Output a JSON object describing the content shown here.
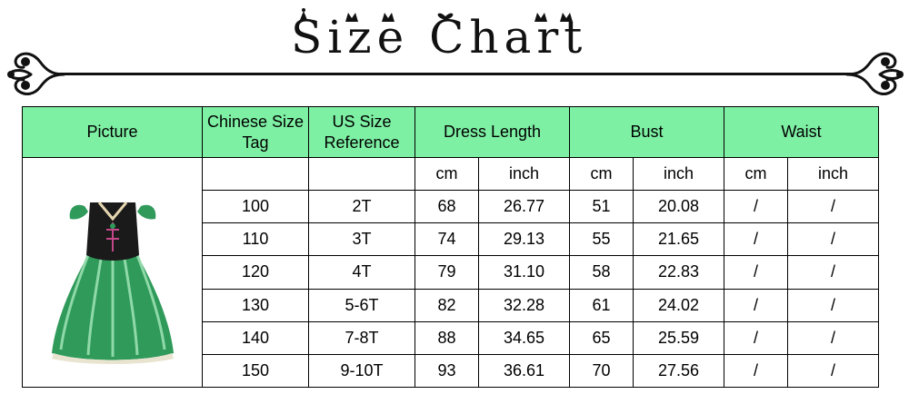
{
  "title": "Size Chart",
  "header": {
    "picture": "Picture",
    "chinese_tag": "Chinese Size Tag",
    "us_ref": "US Size Reference",
    "dress_length": "Dress Length",
    "bust": "Bust",
    "waist": "Waist"
  },
  "units": [
    "cm",
    "inch",
    "cm",
    "inch",
    "cm",
    "inch"
  ],
  "rows": [
    {
      "tag": "100",
      "us": "2T",
      "len_cm": "68",
      "len_in": "26.77",
      "bust_cm": "51",
      "bust_in": "20.08",
      "waist_cm": "/",
      "waist_in": "/"
    },
    {
      "tag": "110",
      "us": "3T",
      "len_cm": "74",
      "len_in": "29.13",
      "bust_cm": "55",
      "bust_in": "21.65",
      "waist_cm": "/",
      "waist_in": "/"
    },
    {
      "tag": "120",
      "us": "4T",
      "len_cm": "79",
      "len_in": "31.10",
      "bust_cm": "58",
      "bust_in": "22.83",
      "waist_cm": "/",
      "waist_in": "/"
    },
    {
      "tag": "130",
      "us": "5-6T",
      "len_cm": "82",
      "len_in": "32.28",
      "bust_cm": "61",
      "bust_in": "24.02",
      "waist_cm": "/",
      "waist_in": "/"
    },
    {
      "tag": "140",
      "us": "7-8T",
      "len_cm": "88",
      "len_in": "34.65",
      "bust_cm": "65",
      "bust_in": "25.59",
      "waist_cm": "/",
      "waist_in": "/"
    },
    {
      "tag": "150",
      "us": "9-10T",
      "len_cm": "93",
      "len_in": "36.61",
      "bust_cm": "70",
      "bust_in": "27.56",
      "waist_cm": "/",
      "waist_in": "/"
    }
  ],
  "colors": {
    "header_bg": "#7ef0a4",
    "border": "#000000",
    "dress_green": "#2f9a5a",
    "dress_bodice": "#1a1a1a"
  },
  "icons": [
    "flourish-ornament-icon",
    "crown-icon",
    "bow-icon",
    "dress-image"
  ]
}
